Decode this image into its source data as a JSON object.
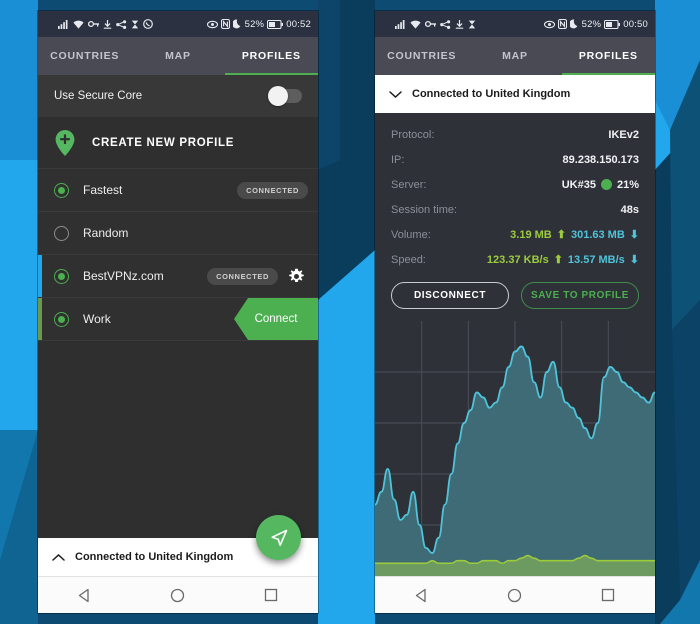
{
  "background": {
    "base_color": "#0d4b73",
    "accent_color": "#22a7ec",
    "dark_color": "#0a3c5c"
  },
  "left_phone": {
    "status_bar": {
      "time": "00:52",
      "battery": "52%",
      "left_icons": [
        "signal-icon",
        "wifi-icon",
        "vpn-key-icon",
        "download-icon",
        "share-icon",
        "hourglass-icon",
        "whatsapp-icon"
      ],
      "right_icons": [
        "eye-icon",
        "dnd-icon",
        "moon-icon",
        "battery-icon"
      ]
    },
    "tabs": [
      {
        "label": "COUNTRIES",
        "active": false
      },
      {
        "label": "MAP",
        "active": false
      },
      {
        "label": "PROFILES",
        "active": true
      }
    ],
    "secure_core": {
      "label": "Use Secure Core",
      "enabled": false
    },
    "create_profile": {
      "label": "CREATE NEW PROFILE",
      "icon": "map-pin-plus-icon"
    },
    "profiles": [
      {
        "name": "Fastest",
        "selected": true,
        "badge": "CONNECTED",
        "gear": false,
        "accent": "none",
        "action": ""
      },
      {
        "name": "Random",
        "selected": false,
        "badge": "",
        "gear": false,
        "accent": "none",
        "action": ""
      },
      {
        "name": "BestVPNz.com",
        "selected": true,
        "badge": "CONNECTED",
        "gear": true,
        "accent": "blue",
        "action": ""
      },
      {
        "name": "Work",
        "selected": true,
        "badge": "",
        "gear": false,
        "accent": "green",
        "action": "Connect"
      }
    ],
    "fab": {
      "icon": "navigation-arrow-icon",
      "color": "#55b861"
    },
    "bottom_sheet": {
      "label": "Connected to United Kingdom",
      "chevron": "chevron-up-icon"
    },
    "nav_bar": [
      "back-triangle-icon",
      "home-circle-icon",
      "recents-square-icon"
    ]
  },
  "right_phone": {
    "status_bar": {
      "time": "00:50",
      "battery": "52%",
      "left_icons": [
        "signal-icon",
        "wifi-icon",
        "vpn-key-icon",
        "share-icon",
        "download-icon",
        "hourglass-icon"
      ],
      "right_icons": [
        "eye-icon",
        "dnd-icon",
        "moon-icon",
        "battery-icon"
      ]
    },
    "tabs": [
      {
        "label": "COUNTRIES",
        "active": false
      },
      {
        "label": "MAP",
        "active": false
      },
      {
        "label": "PROFILES",
        "active": true
      }
    ],
    "header": {
      "label": "Connected to United Kingdom",
      "chevron": "chevron-down-icon"
    },
    "stats": [
      {
        "key": "Protocol:",
        "value": "IKEv2"
      },
      {
        "key": "IP:",
        "value": "89.238.150.173"
      },
      {
        "key": "Server:",
        "value": "UK#35",
        "load": "21%",
        "dot_color": "#4caf50"
      },
      {
        "key": "Session time:",
        "value": "48s"
      },
      {
        "key": "Volume:",
        "up": "3.19 MB",
        "down": "301.63 MB"
      },
      {
        "key": "Speed:",
        "up": "123.37 KB/s",
        "down": "13.57 MB/s"
      }
    ],
    "buttons": {
      "disconnect": "DISCONNECT",
      "save": "SAVE TO PROFILE"
    },
    "colors": {
      "upload": "#9ccc3c",
      "download": "#4fc3d9",
      "download_fill": "#3e6b75",
      "upload_fill": "#6d9a60"
    },
    "nav_bar": [
      "back-triangle-icon",
      "home-circle-icon",
      "recents-square-icon"
    ]
  },
  "chart_data": {
    "type": "area",
    "title": "",
    "xlabel": "",
    "ylabel": "",
    "grid": true,
    "legend_position": "none",
    "ylim": [
      0,
      100
    ],
    "series": [
      {
        "name": "Download",
        "color": "#4fc3d9",
        "fill": "#3e6b75",
        "values": [
          28,
          33,
          42,
          30,
          22,
          24,
          33,
          20,
          11,
          9,
          15,
          28,
          40,
          52,
          60,
          65,
          72,
          70,
          66,
          68,
          74,
          82,
          88,
          90,
          86,
          76,
          70,
          80,
          84,
          74,
          68,
          66,
          62,
          58,
          54,
          60,
          78,
          82,
          80,
          76,
          74,
          72,
          70,
          68,
          72
        ]
      },
      {
        "name": "Upload",
        "color": "#9ccc3c",
        "fill": "#6d9a60",
        "values": [
          5,
          5,
          5,
          5,
          5,
          5,
          5,
          5,
          5,
          6,
          5,
          5,
          5,
          6,
          6,
          5,
          5,
          6,
          6,
          6,
          5,
          6,
          6,
          7,
          8,
          7,
          6,
          6,
          6,
          6,
          6,
          6,
          7,
          8,
          7,
          6,
          6,
          6,
          6,
          6,
          6,
          6,
          6,
          6,
          6
        ]
      }
    ]
  }
}
